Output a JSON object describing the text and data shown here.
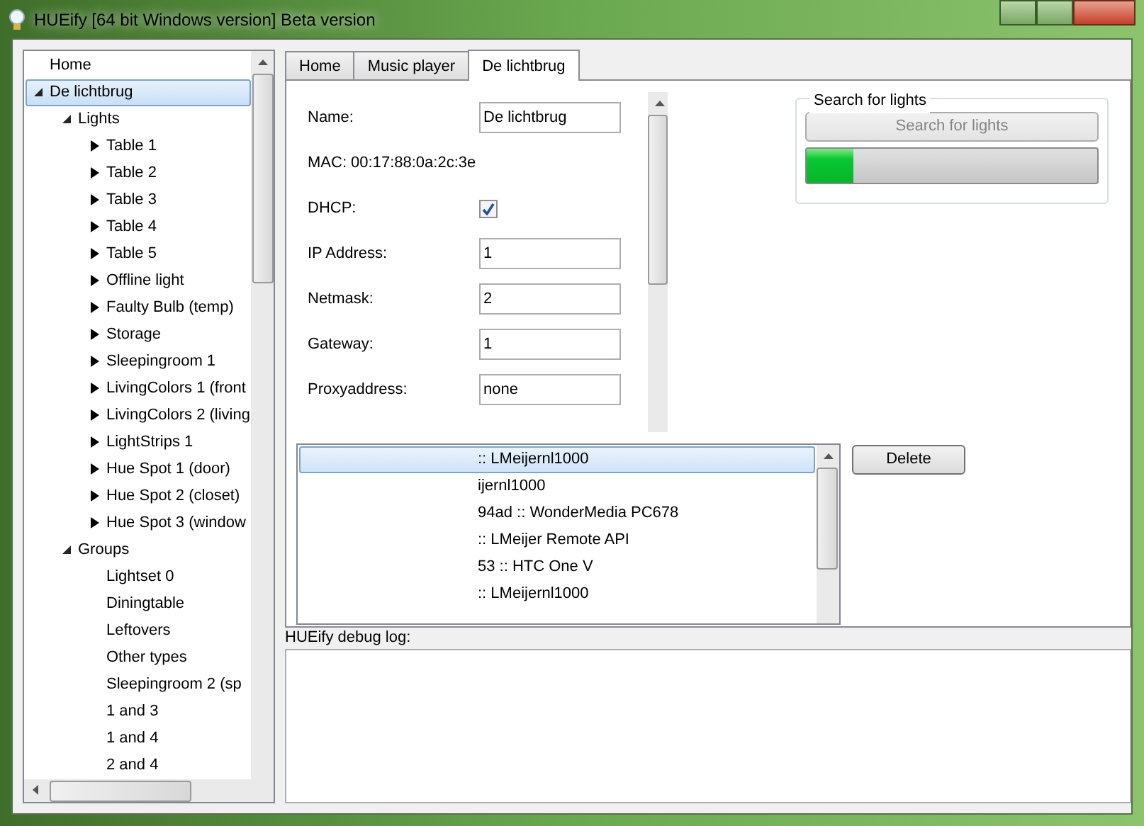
{
  "window": {
    "title": "HUEify [64 bit Windows version] Beta version"
  },
  "tree": [
    {
      "label": "Home"
    },
    {
      "label": "De lichtbrug",
      "expanded": true,
      "selected": true,
      "children": [
        {
          "label": "Lights",
          "expanded": true,
          "selected": false,
          "children": [
            {
              "label": "Table 1",
              "expanded": false,
              "selected": false
            },
            {
              "label": "Table 2",
              "expanded": false,
              "selected": false
            },
            {
              "label": "Table 3",
              "expanded": false,
              "selected": false
            },
            {
              "label": "Table 4",
              "expanded": false,
              "selected": false
            },
            {
              "label": "Table 5",
              "expanded": false,
              "selected": false
            },
            {
              "label": "Offline light",
              "expanded": false,
              "selected": false
            },
            {
              "label": "Faulty Bulb (temp)",
              "expanded": false,
              "selected": false
            },
            {
              "label": "Storage",
              "expanded": false,
              "selected": false
            },
            {
              "label": "Sleepingroom 1",
              "expanded": false,
              "selected": false
            },
            {
              "label": "LivingColors 1 (front",
              "expanded": false,
              "selected": false
            },
            {
              "label": "LivingColors 2 (living",
              "expanded": false,
              "selected": false
            },
            {
              "label": "LightStrips 1",
              "expanded": false,
              "selected": false
            },
            {
              "label": "Hue Spot 1 (door)",
              "expanded": false,
              "selected": false
            },
            {
              "label": "Hue Spot 2 (closet)",
              "expanded": false,
              "selected": false
            },
            {
              "label": "Hue Spot 3 (window",
              "expanded": false,
              "selected": false
            }
          ]
        },
        {
          "label": "Groups",
          "expanded": true,
          "selected": false,
          "children": [
            {
              "label": "Lightset 0",
              "selected": false
            },
            {
              "label": "Diningtable",
              "selected": false
            },
            {
              "label": "Leftovers",
              "selected": false
            },
            {
              "label": "Other types",
              "selected": false
            },
            {
              "label": "Sleepingroom 2 (sp",
              "selected": false
            },
            {
              "label": "1 and 3",
              "selected": false
            },
            {
              "label": "1 and 4",
              "selected": false
            },
            {
              "label": "2 and 4",
              "selected": false
            }
          ]
        }
      ]
    }
  ],
  "tabs": [
    {
      "label": "Home",
      "selected": false
    },
    {
      "label": "Music player",
      "selected": false
    },
    {
      "label": "De lichtbrug",
      "selected": true
    }
  ],
  "form": [
    {
      "kind": "text",
      "label": "Name:",
      "value": "De lichtbrug"
    },
    {
      "kind": "info",
      "label": "MAC: 00:17:88:0a:2c:3e"
    },
    {
      "kind": "checkbox",
      "label": "DHCP:",
      "checked": true
    },
    {
      "kind": "text",
      "label": "IP Address:",
      "value": "1"
    },
    {
      "kind": "text",
      "label": "Netmask:",
      "value": "2"
    },
    {
      "kind": "text",
      "label": "Gateway:",
      "value": "1"
    },
    {
      "kind": "text",
      "label": "Proxyaddress:",
      "value": "none"
    }
  ],
  "search_group": {
    "title": "Search for lights",
    "button": {
      "label": "Search for lights",
      "disabled": true
    },
    "progress": {
      "level": 0.16
    }
  },
  "devices": [
    {
      "label": ":: LMeijernl1000",
      "selected": true
    },
    {
      "label": "ijernl1000",
      "selected": false
    },
    {
      "label": "94ad :: WonderMedia PC678",
      "selected": false
    },
    {
      "label": ":: LMeijer Remote API",
      "selected": false
    },
    {
      "label": "53 :: HTC One V",
      "selected": false
    },
    {
      "label": ":: LMeijernl1000",
      "selected": false
    }
  ],
  "delete_button": "Delete",
  "debug_log": {
    "label": "HUEify debug log:"
  }
}
